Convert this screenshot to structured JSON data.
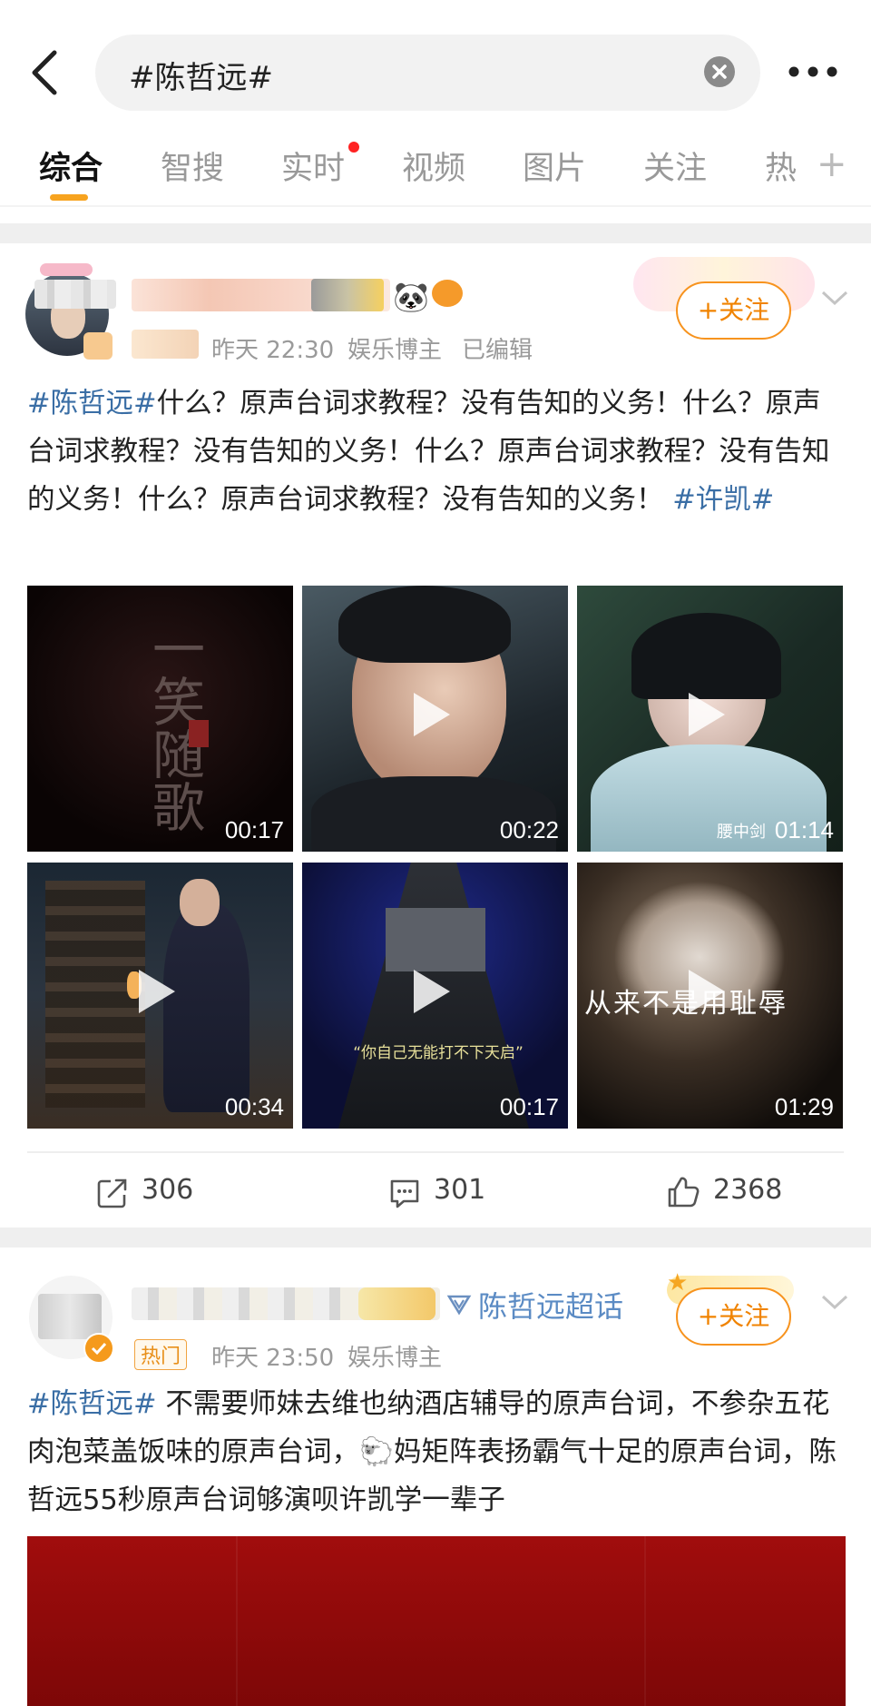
{
  "search": {
    "query": "#陈哲远#"
  },
  "tabs": [
    {
      "label": "综合",
      "active": true
    },
    {
      "label": "智搜"
    },
    {
      "label": "实时",
      "dot": true
    },
    {
      "label": "视频"
    },
    {
      "label": "图片"
    },
    {
      "label": "关注"
    },
    {
      "label": "热"
    }
  ],
  "post1": {
    "meta": {
      "time": "昨天 22:30",
      "role": "娱乐博主",
      "edited": "已编辑"
    },
    "follow_label": "+关注",
    "text_tag": "#陈哲远#",
    "text_body": "什么？原声台词求教程？没有告知的义务！什么？原声台词求教程？没有告知的义务！什么？原声台词求教程？没有告知的义务！什么？原声台词求教程？没有告知的义务！ ",
    "text_tag2": "#许凯#",
    "videos": [
      {
        "duration": "00:17",
        "overlay": "一笑随歌"
      },
      {
        "duration": "00:22"
      },
      {
        "duration": "01:14",
        "caption": "腰中剑"
      },
      {
        "duration": "00:34"
      },
      {
        "duration": "00:17",
        "caption": "“你自己无能打不下天启”"
      },
      {
        "duration": "01:29",
        "caption": "从来不是用耻辱"
      }
    ],
    "actions": {
      "repost": "306",
      "comments": "301",
      "likes": "2368"
    }
  },
  "post2": {
    "badge": "热门",
    "meta": {
      "time": "昨天 23:50",
      "role": "娱乐博主"
    },
    "super_topic": "陈哲远超话",
    "follow_label": "+关注",
    "text_tag": "#陈哲远#",
    "text_body": " 不需要师妹去维也纳酒店辅导的原声台词，不参杂五花肉泡菜盖饭味的原声台词，🐑妈矩阵表扬霸气十足的原声台词，陈哲远55秒原声台词够演呗许凯学一辈子"
  }
}
